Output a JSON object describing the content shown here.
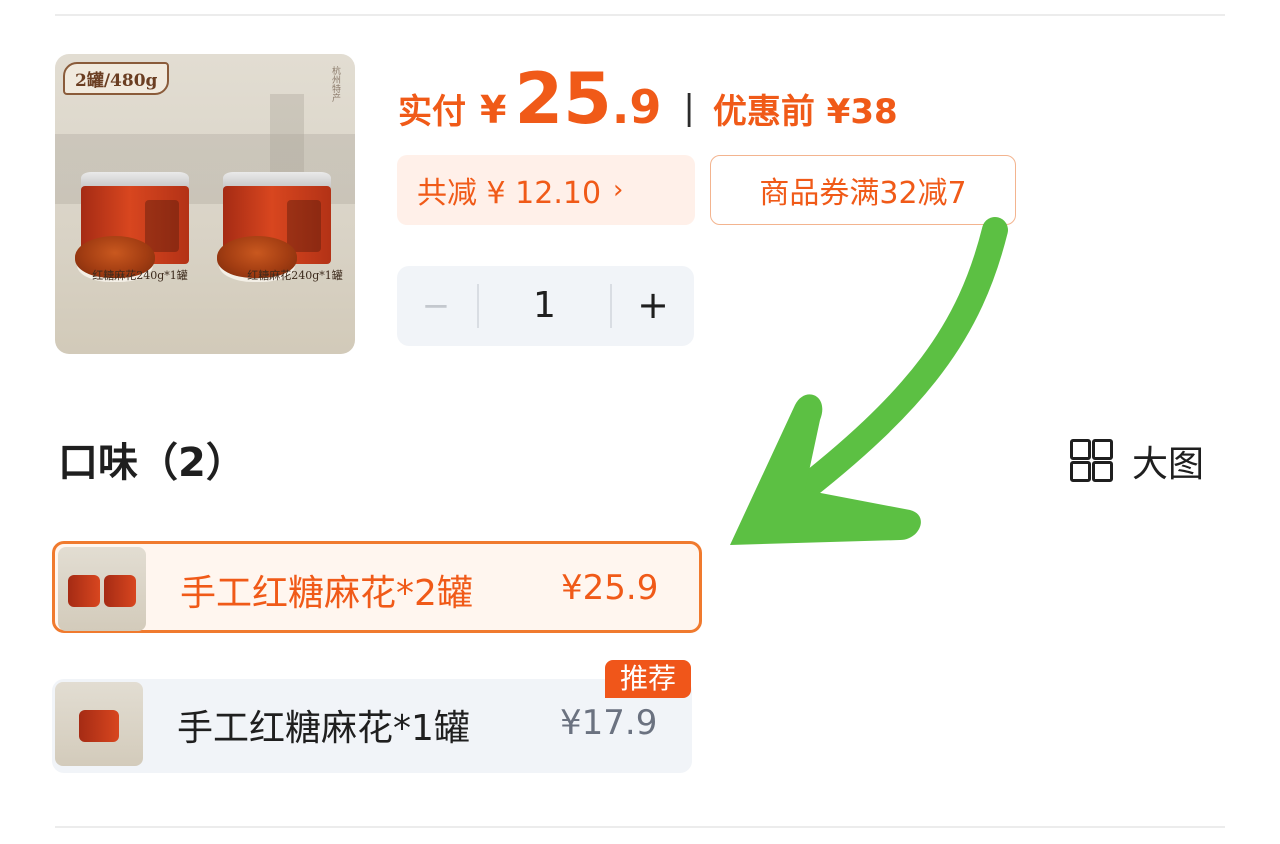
{
  "product": {
    "image_badge": "2罐/480g",
    "image_side_text": "杭州特产",
    "image_caption_left": "红糖麻花240g*1罐",
    "image_caption_right": "红糖麻花240g*1罐"
  },
  "price": {
    "pay_label": "实付",
    "currency": "¥",
    "amount_int": "25",
    "amount_dec": ".9",
    "separator": "|",
    "before_label": "优惠前 ¥38"
  },
  "discounts": {
    "total_reduce": "共减 ¥ 12.10",
    "total_reduce_chevron": "›",
    "coupon": "商品券满32减7"
  },
  "stepper": {
    "minus": "−",
    "quantity": "1",
    "plus": "+"
  },
  "flavor": {
    "title": "口味（2）",
    "big_view_label": "大图",
    "options": [
      {
        "name": "手工红糖麻花*2罐",
        "price": "¥25.9",
        "selected": true
      },
      {
        "name": "手工红糖麻花*1罐",
        "price": "¥17.9",
        "selected": false,
        "badge": "推荐"
      }
    ]
  },
  "colors": {
    "accent": "#f05a18",
    "arrow": "#5cc043"
  }
}
